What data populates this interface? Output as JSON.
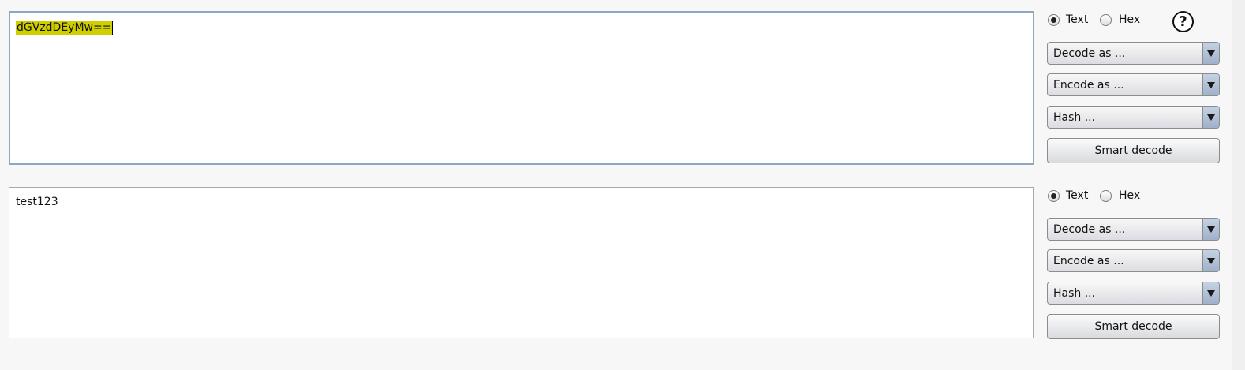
{
  "panels": [
    {
      "text_value": "dGVzdDEyMw==",
      "format_options": [
        "Text",
        "Hex"
      ],
      "selected_format": "Text",
      "decode_label": "Decode as ...",
      "encode_label": "Encode as ...",
      "hash_label": "Hash ...",
      "smart_decode_label": "Smart decode",
      "help_symbol": "?"
    },
    {
      "text_value": "test123",
      "format_options": [
        "Text",
        "Hex"
      ],
      "selected_format": "Text",
      "decode_label": "Decode as ...",
      "encode_label": "Encode as ...",
      "hash_label": "Hash ...",
      "smart_decode_label": "Smart decode"
    }
  ],
  "colors": {
    "selection_highlight": "#cfcf00",
    "focused_border": "#8fa8c0",
    "dropdown_arrow": "#9fb1c9"
  },
  "icons": [
    "help-icon",
    "dropdown-arrow-icon",
    "radio-checked-icon",
    "radio-unchecked-icon"
  ]
}
